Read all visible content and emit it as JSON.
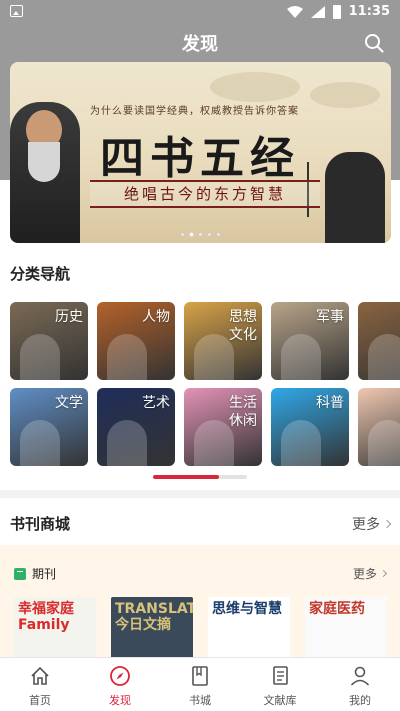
{
  "status_bar": {
    "time": "11:35"
  },
  "header": {
    "title": "发现"
  },
  "banner": {
    "subtitle": "为什么要读国学经典，权威教授告诉你答案",
    "title": "四书五经",
    "slogan": "绝唱古今的东方智慧",
    "dot_count": 5,
    "active_dot": 1
  },
  "categories": {
    "title": "分类导航",
    "items": [
      {
        "label": "历史",
        "color": "#7a6a55",
        "icon": "terracotta-warrior-image"
      },
      {
        "label": "人物",
        "color": "#b5622a",
        "icon": "confucius-statue-image"
      },
      {
        "label": "思想文化",
        "color": "#d9a348",
        "icon": "glasses-image"
      },
      {
        "label": "军事",
        "color": "#b9a58a",
        "icon": "tank-image"
      },
      {
        "label": "",
        "color": "#8a6440",
        "icon": "gavel-image"
      },
      {
        "label": "文学",
        "color": "#5f8fc7",
        "icon": "river-landscape-image"
      },
      {
        "label": "艺术",
        "color": "#1f2e5a",
        "icon": "opera-mask-image"
      },
      {
        "label": "生活休闲",
        "color": "#e493b7",
        "icon": "ballerina-image"
      },
      {
        "label": "科普",
        "color": "#2fa8e8",
        "icon": "airplane-image"
      },
      {
        "label": "",
        "color": "#f0c7b0",
        "icon": "pregnancy-image"
      }
    ],
    "scroll_progress": 0.7
  },
  "bookstore": {
    "title": "书刊商城",
    "more": "更多",
    "periodicals": {
      "label": "期刊",
      "more": "更多",
      "magazines": [
        {
          "title": "幸福家庭 Family",
          "color": "#f4f4ee",
          "text_color": "#d92b2b"
        },
        {
          "title": "TRANSLATION 今日文摘",
          "color": "#3b4a5a",
          "text_color": "#d8c27a"
        },
        {
          "title": "思维与智慧",
          "color": "#ffffff",
          "text_color": "#1a3d6b"
        },
        {
          "title": "家庭医药",
          "color": "#fafafa",
          "text_color": "#c0392b"
        }
      ]
    }
  },
  "tabbar": {
    "items": [
      {
        "label": "首页",
        "icon": "home-icon"
      },
      {
        "label": "发现",
        "icon": "compass-icon"
      },
      {
        "label": "书城",
        "icon": "bookmark-book-icon"
      },
      {
        "label": "文献库",
        "icon": "document-icon"
      },
      {
        "label": "我的",
        "icon": "user-icon"
      }
    ],
    "active_index": 1
  },
  "colors": {
    "accent": "#d9263a",
    "header_bg": "#9a9a9a",
    "card_bg": "#fff5e9"
  }
}
